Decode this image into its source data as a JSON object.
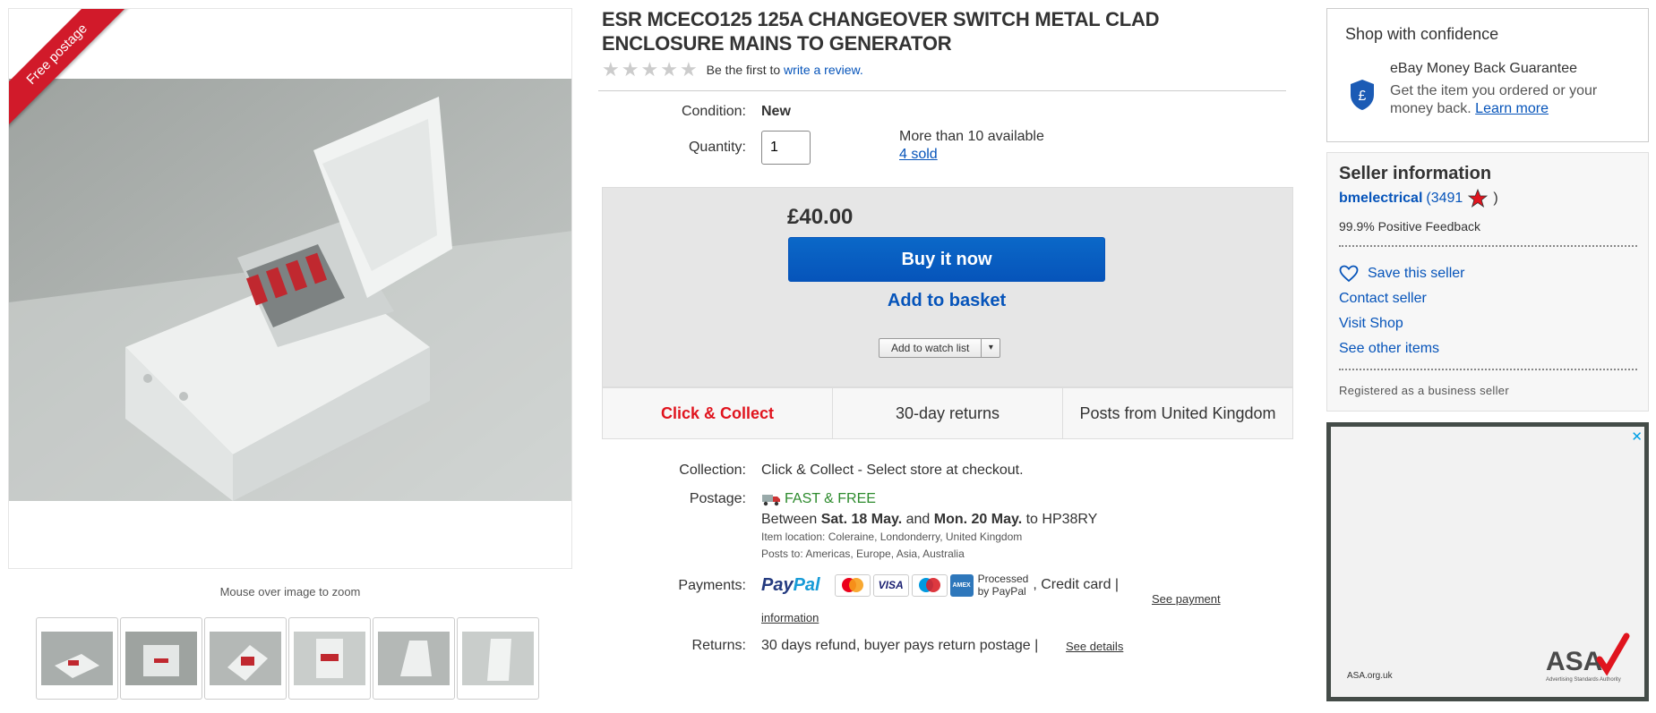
{
  "gallery": {
    "ribbon": "Free postage",
    "zoom_hint": "Mouse over image to zoom",
    "thumbnail_count": 6
  },
  "item": {
    "title": "ESR MCECO125 125A CHANGEOVER SWITCH METAL CLAD ENCLOSURE MAINS TO GENERATOR",
    "rating_stars": 0,
    "review_prefix": "Be the first to",
    "review_link": "write a review.",
    "condition_label": "Condition:",
    "condition_value": "New",
    "quantity_label": "Quantity:",
    "quantity_value": "1",
    "availability": "More than 10 available",
    "sold": "4 sold"
  },
  "buy_box": {
    "price": "£40.00",
    "buy_now": "Buy it now",
    "add_to_basket": "Add to basket",
    "watch_list": "Add to watch list",
    "watch_dropdown": "▾"
  },
  "features": {
    "click_collect": "Click & Collect",
    "returns": "30-day returns",
    "posts_from": "Posts from United Kingdom"
  },
  "details": {
    "collection_label": "Collection:",
    "collection_value": "Click & Collect - Select store at checkout.",
    "postage_label": "Postage:",
    "postage_value": "FAST & FREE",
    "delivery_between": "Between",
    "delivery_start": "Sat. 18 May.",
    "delivery_and": "and",
    "delivery_end": "Mon. 20 May.",
    "delivery_to": "to HP38RY",
    "item_location": "Item location:  Coleraine, Londonderry, United Kingdom",
    "posts_to": "Posts to:  Americas, Europe, Asia, Australia",
    "payments_label": "Payments:",
    "paypal_pay": "Pay",
    "paypal_pal": "Pal",
    "card_mastercard": "MasterCard",
    "card_visa": "VISA",
    "card_maestro": "Maestro",
    "card_amex": "AMEX",
    "processed_1": "Processed",
    "processed_2": "by PayPal",
    "credit_card": ",   Credit card  |",
    "see_payment_1": "See payment",
    "see_payment_2": "information",
    "returns_label": "Returns:",
    "returns_value": "30 days refund, buyer pays return postage |",
    "see_details": "See details"
  },
  "confidence": {
    "title": "Shop with confidence",
    "guarantee_title": "eBay Money Back Guarantee",
    "guarantee_desc": "Get the item you ordered or your money back.",
    "learn_more": "Learn more"
  },
  "seller": {
    "title": "Seller information",
    "name": "bmelectrical",
    "score_open": "(3491",
    "score_close": ")",
    "positive_feedback": "99.9% Positive Feedback",
    "save_seller": "Save this seller",
    "contact": "Contact seller",
    "visit_shop": "Visit Shop",
    "see_other": "See other items",
    "business": "Registered as a business seller"
  },
  "ad": {
    "close": "✕",
    "url": "ASA.org.uk",
    "logo_text": "ASA",
    "logo_sub": "Advertising Standards Authority"
  },
  "colors": {
    "ebay_blue": "#0654ba",
    "ribbon_red": "#d11a2a",
    "click_collect_red": "#e0141e",
    "free_green": "#2d8b2d"
  }
}
